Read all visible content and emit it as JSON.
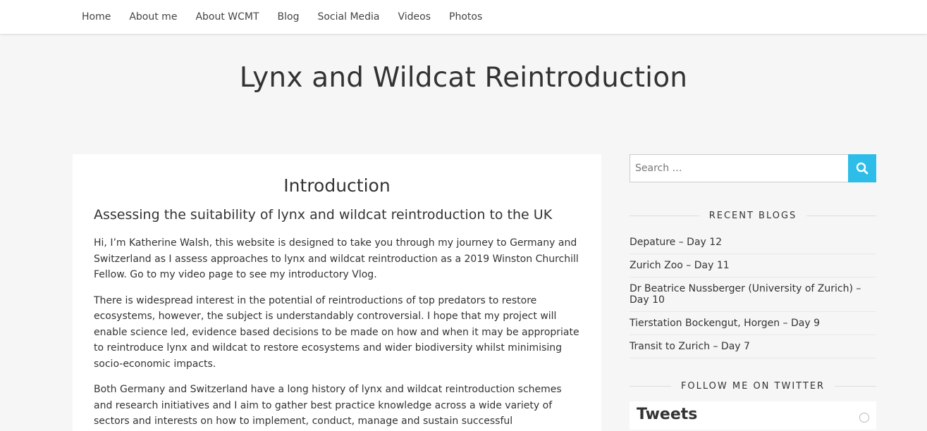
{
  "nav": {
    "items": [
      "Home",
      "About me",
      "About WCMT",
      "Blog",
      "Social Media",
      "Videos",
      "Photos"
    ]
  },
  "site": {
    "title": "Lynx and Wildcat Reintroduction"
  },
  "main": {
    "heading": "Introduction",
    "subheading": "Assessing the suitability of lynx and wildcat reintroduction to the UK",
    "paragraphs": [
      "Hi, I’m Katherine Walsh, this website is designed to take you through my journey to Germany and Switzerland as I assess approaches to lynx and wildcat reintroduction as a 2019 Winston Churchill Fellow. Go to my video page to see my introductory Vlog.",
      "There is widespread interest in the potential of reintroductions of top predators to restore ecosystems, however, the subject is understandably controversial. I hope that my project will enable science led, evidence based decisions to be made on how and when it may be appropriate to reintroduce lynx and wildcat to restore ecosystems and wider biodiversity whilst minimising socio-economic impacts.",
      "Both Germany and Switzerland have a long history of lynx and wildcat reintroduction schemes and research initiatives and I aim to gather best practice knowledge across a wide variety of sectors and interests on how to implement, conduct, manage and sustain successful reintroduction projects for these species."
    ]
  },
  "sidebar": {
    "search": {
      "placeholder": "Search …",
      "icon": "search-icon"
    },
    "recent_title": "RECENT BLOGS",
    "recent": [
      "Depature – Day 12",
      "Zurich Zoo – Day 11",
      "Dr Beatrice Nussberger (University of Zurich) – Day 10",
      "Tierstation Bockengut, Horgen – Day 9",
      "Transit to Zurich – Day 7"
    ],
    "twitter_title": "FOLLOW ME ON TWITTER",
    "twitter_heading": "Tweets"
  },
  "colors": {
    "accent": "#2dbde8",
    "background": "#f6f6f6"
  }
}
